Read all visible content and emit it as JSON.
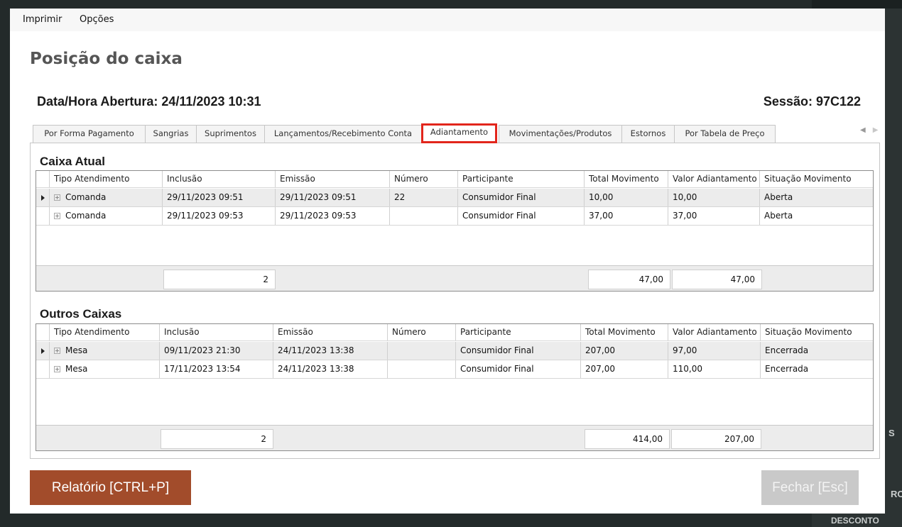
{
  "menu": {
    "items": [
      "Imprimir",
      "Opções"
    ]
  },
  "page": {
    "title": "Posição do caixa",
    "opening_label": "Data/Hora Abertura: 24/11/2023 10:31",
    "session_label": "Sessão: 97C122"
  },
  "tabs": [
    "Por Forma Pagamento",
    "Sangrias",
    "Suprimentos",
    "Lançamentos/Recebimento Conta",
    "Adiantamento",
    "Movimentações/Produtos",
    "Estornos",
    "Por Tabela de Preço"
  ],
  "active_tab": "Adiantamento",
  "columns": [
    "Tipo Atendimento",
    "Inclusão",
    "Emissão",
    "Número",
    "Participante",
    "Total Movimento",
    "Valor Adiantamento",
    "Situação Movimento"
  ],
  "caixa_atual": {
    "title": "Caixa Atual",
    "rows": [
      [
        "Comanda",
        "29/11/2023 09:51",
        "29/11/2023 09:51",
        "22",
        "Consumidor Final",
        "10,00",
        "10,00",
        "Aberta"
      ],
      [
        "Comanda",
        "29/11/2023 09:53",
        "29/11/2023 09:53",
        "",
        "Consumidor Final",
        "37,00",
        "37,00",
        "Aberta"
      ]
    ],
    "footer": {
      "count": "2",
      "total_movimento": "47,00",
      "valor_adiantamento": "47,00"
    }
  },
  "outros_caixas": {
    "title": "Outros Caixas",
    "rows": [
      [
        "Mesa",
        "09/11/2023 21:30",
        "24/11/2023 13:38",
        "",
        "Consumidor Final",
        "207,00",
        "97,00",
        "Encerrada"
      ],
      [
        "Mesa",
        "17/11/2023 13:54",
        "24/11/2023 13:38",
        "",
        "Consumidor Final",
        "207,00",
        "110,00",
        "Encerrada"
      ]
    ],
    "footer": {
      "count": "2",
      "total_movimento": "414,00",
      "valor_adiantamento": "207,00"
    }
  },
  "buttons": {
    "report": "Relatório [CTRL+P]",
    "close": "Fechar [Esc]"
  },
  "background_app": {
    "text_s": "S",
    "text_ro": "RO",
    "text_desconto": "DESCONTO"
  },
  "colors": {
    "report_button": "#a24c2b",
    "close_button": "#c9c9c9",
    "active_tab_outline": "#e2261c",
    "title_text": "#555555"
  }
}
